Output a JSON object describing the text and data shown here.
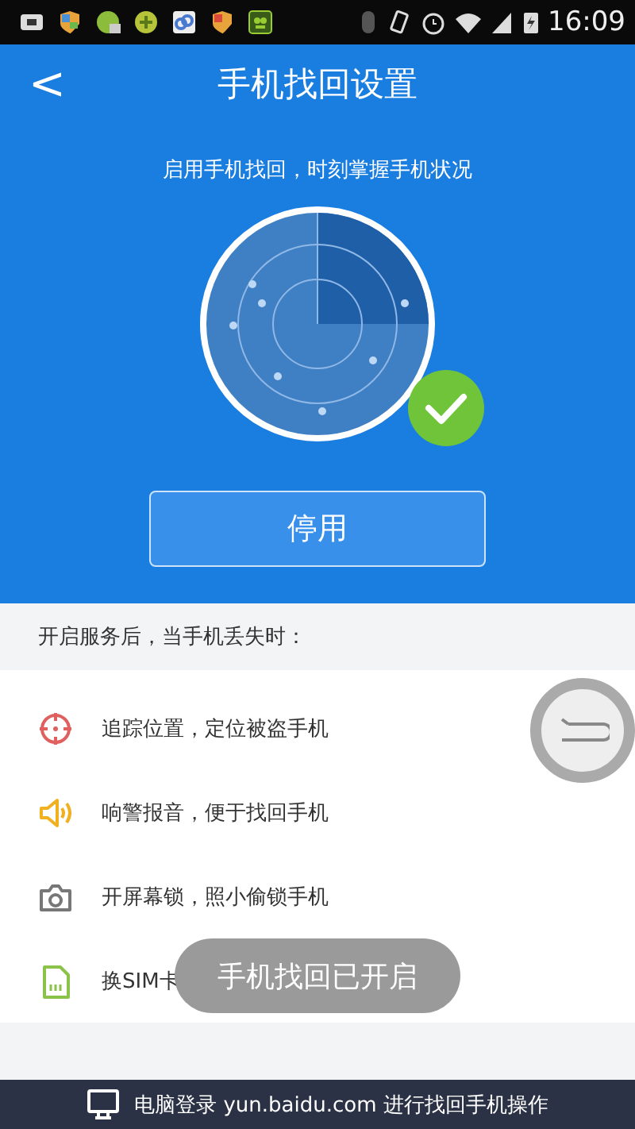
{
  "status_bar": {
    "time": "16:09"
  },
  "header": {
    "back": "<",
    "title": "手机找回设置",
    "subtitle": "启用手机找回，时刻掌握手机状况",
    "button": "停用"
  },
  "section": {
    "title": "开启服务后，当手机丢失时："
  },
  "features": [
    {
      "kind": "locate",
      "text": "追踪位置，定位被盗手机"
    },
    {
      "kind": "alarm",
      "text": "响警报音，便于找回手机"
    },
    {
      "kind": "camera",
      "text": "开屏幕锁，照小偷锁手机"
    },
    {
      "kind": "sim",
      "text": "换SIM卡"
    }
  ],
  "toast": "手机找回已开启",
  "footer": {
    "text": "电脑登录 yun.baidu.com 进行找回手机操作"
  }
}
